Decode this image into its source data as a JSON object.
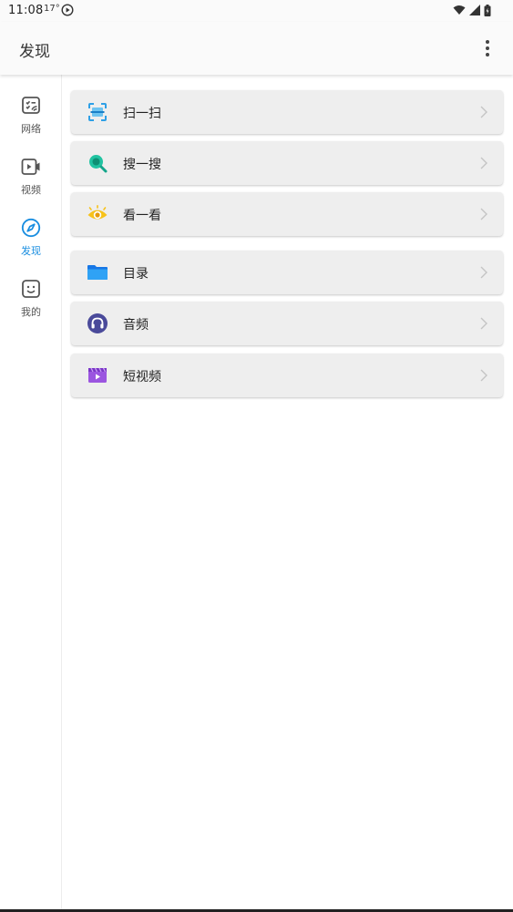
{
  "status_bar": {
    "time": "11:08",
    "temperature": "17°",
    "icons": [
      "play-circle-icon",
      "wifi-icon",
      "signal-icon",
      "battery-icon"
    ]
  },
  "app_bar": {
    "title": "发现",
    "more_icon": "more-vert-icon"
  },
  "sidebar": {
    "items": [
      {
        "label": "网络",
        "icon": "network-list-icon",
        "active": false
      },
      {
        "label": "视频",
        "icon": "video-icon",
        "active": false
      },
      {
        "label": "发现",
        "icon": "compass-icon",
        "active": true
      },
      {
        "label": "我的",
        "icon": "smile-face-icon",
        "active": false
      }
    ],
    "active_color": "#1a8ee0"
  },
  "main": {
    "cards": [
      {
        "label": "扫一扫",
        "icon": "scan-icon"
      },
      {
        "label": "搜一搜",
        "icon": "search-icon"
      },
      {
        "label": "看一看",
        "icon": "eye-icon"
      },
      {
        "label": "目录",
        "icon": "folder-icon"
      },
      {
        "label": "音频",
        "icon": "headphones-icon"
      },
      {
        "label": "短视频",
        "icon": "short-video-icon"
      }
    ]
  }
}
